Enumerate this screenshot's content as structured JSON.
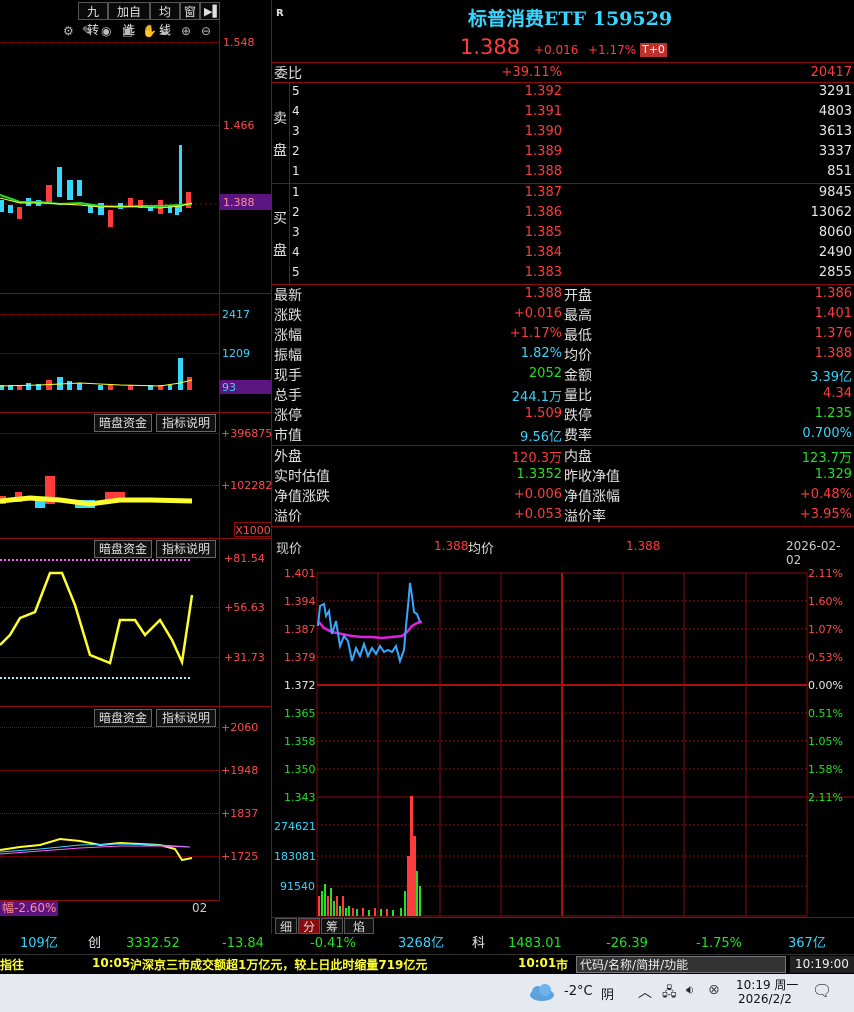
{
  "toolbar": {
    "nine_turn": "九转",
    "add_watch": "加自选",
    "avg_line": "均线",
    "window": "窗"
  },
  "left": {
    "price_axis": [
      "1.548",
      "1.466",
      "1.388"
    ],
    "vol_axis": [
      "2417",
      "1209",
      "93"
    ],
    "p3": {
      "btn1": "暗盘资金",
      "btn2": "指标说明",
      "axis": [
        "+396875",
        "+102282"
      ],
      "unit": "X1000"
    },
    "p4": {
      "btn1": "暗盘资金",
      "btn2": "指标说明",
      "axis": [
        "+81.54",
        "+56.63",
        "+31.73"
      ]
    },
    "p5": {
      "btn1": "暗盘资金",
      "btn2": "指标说明",
      "axis": [
        "+2060",
        "+1948",
        "+1837",
        "+1725"
      ],
      "range_label": "幅-2.60%",
      "date": "02"
    }
  },
  "header": {
    "r_label": "R",
    "title": "标普消费ETF 159529",
    "price": "1.388",
    "change": "+0.016",
    "pct": "+1.17%",
    "badge": "T+0"
  },
  "book": {
    "weibi_label": "委比",
    "weibi_pct": "+39.11%",
    "weibi_vol": "20417",
    "sell_label": [
      "卖",
      "盘"
    ],
    "sells": [
      {
        "lvl": "5",
        "price": "1.392",
        "vol": "3291"
      },
      {
        "lvl": "4",
        "price": "1.391",
        "vol": "4803"
      },
      {
        "lvl": "3",
        "price": "1.390",
        "vol": "3613"
      },
      {
        "lvl": "2",
        "price": "1.389",
        "vol": "3337"
      },
      {
        "lvl": "1",
        "price": "1.388",
        "vol": "851"
      }
    ],
    "buy_label": [
      "买",
      "盘"
    ],
    "buys": [
      {
        "lvl": "1",
        "price": "1.387",
        "vol": "9845"
      },
      {
        "lvl": "2",
        "price": "1.386",
        "vol": "13062"
      },
      {
        "lvl": "3",
        "price": "1.385",
        "vol": "8060"
      },
      {
        "lvl": "4",
        "price": "1.384",
        "vol": "2490"
      },
      {
        "lvl": "5",
        "price": "1.383",
        "vol": "2855"
      }
    ]
  },
  "stats": [
    {
      "l1": "最新",
      "v1": "1.388",
      "c1": "red",
      "l2": "开盘",
      "v2": "1.386",
      "c2": "red"
    },
    {
      "l1": "涨跌",
      "v1": "+0.016",
      "c1": "red",
      "l2": "最高",
      "v2": "1.401",
      "c2": "red"
    },
    {
      "l1": "涨幅",
      "v1": "+1.17%",
      "c1": "red",
      "l2": "最低",
      "v2": "1.376",
      "c2": "red"
    },
    {
      "l1": "振幅",
      "v1": "1.82%",
      "c1": "cyan",
      "l2": "均价",
      "v2": "1.388",
      "c2": "red"
    },
    {
      "l1": "现手",
      "v1": "2052",
      "c1": "green",
      "l2": "金额",
      "v2": "3.39亿",
      "c2": "cyan"
    },
    {
      "l1": "总手",
      "v1": "244.1万",
      "c1": "cyan",
      "l2": "量比",
      "v2": "4.34",
      "c2": "red"
    },
    {
      "l1": "涨停",
      "v1": "1.509",
      "c1": "red",
      "l2": "跌停",
      "v2": "1.235",
      "c2": "green"
    },
    {
      "l1": "市值",
      "v1": "9.56亿",
      "c1": "cyan",
      "l2": "费率",
      "v2": "0.700%",
      "c2": "cyan"
    }
  ],
  "stats2": [
    {
      "l1": "外盘",
      "v1": "120.3万",
      "c1": "red",
      "l2": "内盘",
      "v2": "123.7万",
      "c2": "green"
    },
    {
      "l1": "实时估值",
      "v1": "1.3352",
      "c1": "green",
      "l2": "昨收净值",
      "v2": "1.329",
      "c2": "green"
    },
    {
      "l1": "净值涨跌",
      "v1": "+0.006",
      "c1": "red",
      "l2": "净值涨幅",
      "v2": "+0.48%",
      "c2": "red"
    },
    {
      "l1": "溢价",
      "v1": "+0.053",
      "c1": "red",
      "l2": "溢价率",
      "v2": "+3.95%",
      "c2": "red"
    }
  ],
  "intraday": {
    "now_label": "现价",
    "now_value": "1.388",
    "avg_label": "均价",
    "avg_value": "1.388",
    "date": "2026-02-02",
    "price_axis": [
      "1.401",
      "1.394",
      "1.387",
      "1.379",
      "1.372",
      "1.365",
      "1.358",
      "1.350",
      "1.343"
    ],
    "pct_axis": [
      "2.11%",
      "1.60%",
      "1.07%",
      "0.53%",
      "0.00%",
      "0.51%",
      "1.05%",
      "1.58%",
      "2.11%"
    ],
    "vol_axis": [
      "274621",
      "183081",
      "91540"
    ],
    "tabs": [
      "细",
      "分",
      "筹",
      "焰"
    ]
  },
  "ticker": {
    "a": "109亿",
    "b": "创",
    "c": "3332.52",
    "d": "-13.84",
    "e": "-0.41%",
    "f": "3268亿",
    "g": "科",
    "h": "1483.01",
    "i": "-26.39",
    "j": "-1.75%",
    "k": "367亿"
  },
  "news": {
    "left": "指往",
    "t1": "10:05",
    "m1": "沪深京三市成交额超1万亿元，较上日此时缩量719亿元",
    "t2": "10:01",
    "m2": "市",
    "search_placeholder": "代码/名称/简拼/功能",
    "clock": "10:19:00"
  },
  "taskbar": {
    "temp": "-2°C",
    "weather": "阴",
    "time": "10:19 周一",
    "date": "2026/2/2"
  }
}
